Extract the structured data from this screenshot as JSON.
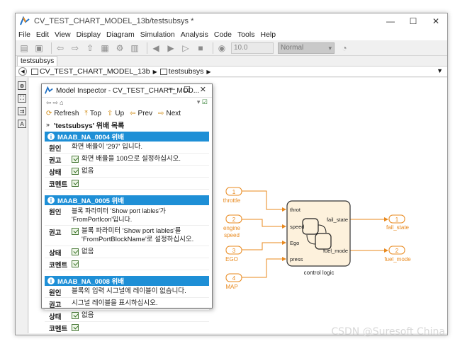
{
  "window": {
    "title": "CV_TEST_CHART_MODEL_13b/testsubsys *"
  },
  "menu": [
    "File",
    "Edit",
    "View",
    "Display",
    "Diagram",
    "Simulation",
    "Analysis",
    "Code",
    "Tools",
    "Help"
  ],
  "toolbar": {
    "stop_time": "10.0",
    "sim_mode": "Normal"
  },
  "tab": {
    "label": "testsubsys"
  },
  "breadcrumb": {
    "model": "CV_TEST_CHART_MODEL_13b",
    "subsystem": "testsubsys"
  },
  "inspector": {
    "title": "Model Inspector - CV_TEST_CHART_MOD...",
    "nav": {
      "refresh": "Refresh",
      "top": "Top",
      "up": "Up",
      "prev": "Prev",
      "next": "Next"
    },
    "list_title": "'testsubsys' 위배 목록",
    "issues": [
      {
        "id": "MAAB_NA_0004  위배",
        "cause_key": "원인",
        "cause": "화면 배율이 '297' 입니다.",
        "advice_key": "권고",
        "advice": "화면 배율을 100으로 설정하십시오.",
        "status_key": "상태",
        "status": "없음",
        "comment_key": "코멘트"
      },
      {
        "id": "MAAB_NA_0005  위배",
        "cause_key": "원인",
        "cause": "블록 파라미터 'Show port lables'가 'FromPortIcon'입니다.",
        "advice_key": "권고",
        "advice": "블록 파라미터 'Show port lables'를 'FromPortBlockName'로 설정하십시오.",
        "status_key": "상태",
        "status": "없음",
        "comment_key": "코멘트"
      },
      {
        "id": "MAAB_NA_0008  위배",
        "cause_key": "원인",
        "cause": "블록의 입력 시그널에 레이블이 없습니다.",
        "advice_key": "권고",
        "advice": "시그널 레이블을 표시하십시오.",
        "status_key": "상태",
        "status": "없음",
        "comment_key": "코멘트"
      }
    ]
  },
  "diagram": {
    "inports": [
      {
        "num": "1",
        "label": "throttle"
      },
      {
        "num": "2",
        "label": "engine speed"
      },
      {
        "num": "3",
        "label": "EGO"
      },
      {
        "num": "4",
        "label": "MAP"
      }
    ],
    "chart": {
      "name": "control logic",
      "inputs": [
        "throt",
        "speed",
        "Ego",
        "press"
      ],
      "outputs": [
        "fail_state",
        "fuel_mode"
      ]
    },
    "outports": [
      {
        "num": "1",
        "label": "fail_state"
      },
      {
        "num": "2",
        "label": "fuel_mode"
      }
    ],
    "port_color": "#e8891e",
    "chart_fill": "#fdf1dc"
  },
  "watermark": "CSDN @Suresoft China"
}
